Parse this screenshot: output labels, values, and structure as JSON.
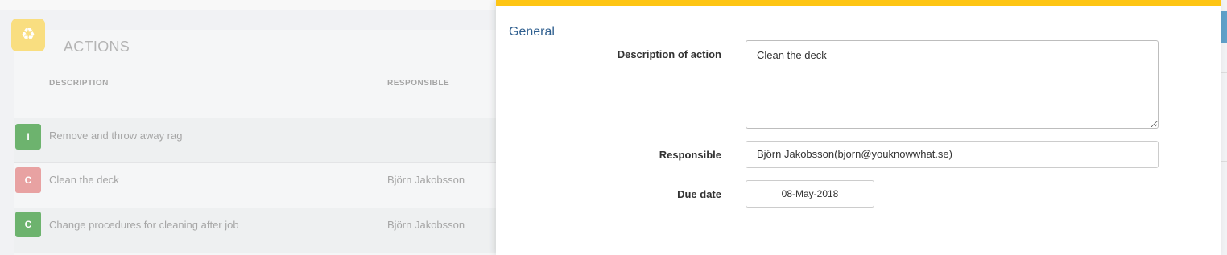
{
  "actions": {
    "icon": "recycle-icon",
    "title": "ACTIONS",
    "columns": {
      "description": "DESCRIPTION",
      "responsible": "RESPONSIBLE"
    },
    "rows": [
      {
        "badge": "I",
        "badge_color": "#6db36e",
        "description": "Remove and throw away rag",
        "responsible": ""
      },
      {
        "badge": "C",
        "badge_color": "#e8a2a2",
        "description": "Clean the deck",
        "responsible": "Björn Jakobsson"
      },
      {
        "badge": "C",
        "badge_color": "#6db36e",
        "description": "Change procedures for cleaning after job",
        "responsible": "Björn Jakobsson"
      }
    ]
  },
  "modal": {
    "accent_color": "#fec514",
    "section_title": "General",
    "fields": {
      "description_label": "Description of action",
      "description_value": "Clean the deck",
      "responsible_label": "Responsible",
      "responsible_value": "Björn Jakobsson(bjorn@youknowwhat.se)",
      "due_date_label": "Due date",
      "due_date_value": "08-May-2018"
    }
  }
}
